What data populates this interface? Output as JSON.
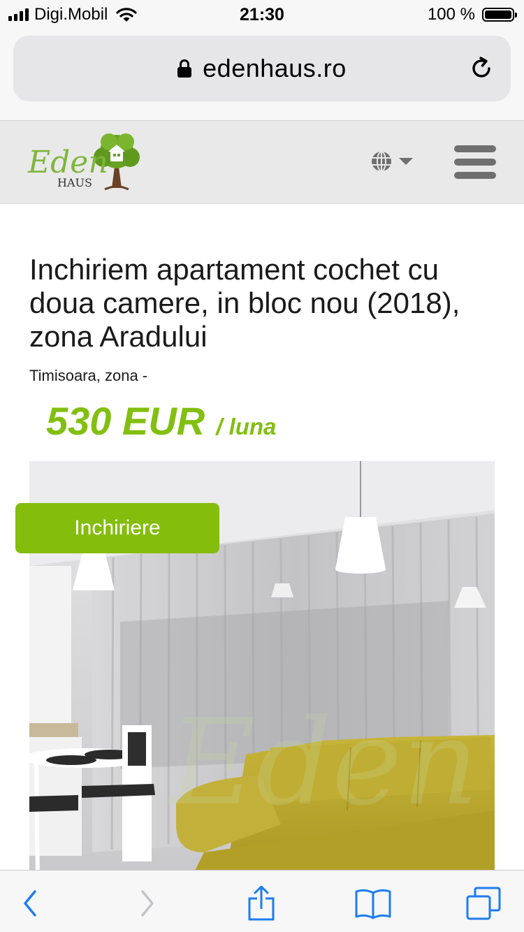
{
  "status_bar": {
    "carrier": "Digi.Mobil",
    "time": "21:30",
    "battery_percent": "100 %",
    "battery_level": 1.0,
    "icons": [
      "signal-icon",
      "wifi-icon",
      "battery-icon"
    ]
  },
  "browser": {
    "url": "edenhaus.ro",
    "icons": [
      "lock-icon",
      "reload-icon"
    ],
    "toolbar_icons": [
      "back-icon",
      "forward-icon",
      "share-icon",
      "bookmarks-icon",
      "tabs-icon"
    ]
  },
  "site_header": {
    "logo_text": "Eden",
    "logo_subtext": "HAUS",
    "icons": [
      "globe-icon",
      "caret-down-icon",
      "hamburger-menu-icon"
    ]
  },
  "listing": {
    "title": "Inchiriem apartament cochet cu doua camere, in bloc nou (2018), zona Aradului",
    "location": "Timisoara, zona -",
    "price": "530 EUR",
    "price_unit": "/ luna",
    "badge": "Inchiriere"
  },
  "colors": {
    "accent_green": "#82bf10",
    "badge_green": "#84bd0c",
    "ios_blue": "#1d7cf2",
    "header_gray": "#e9e9e9"
  }
}
